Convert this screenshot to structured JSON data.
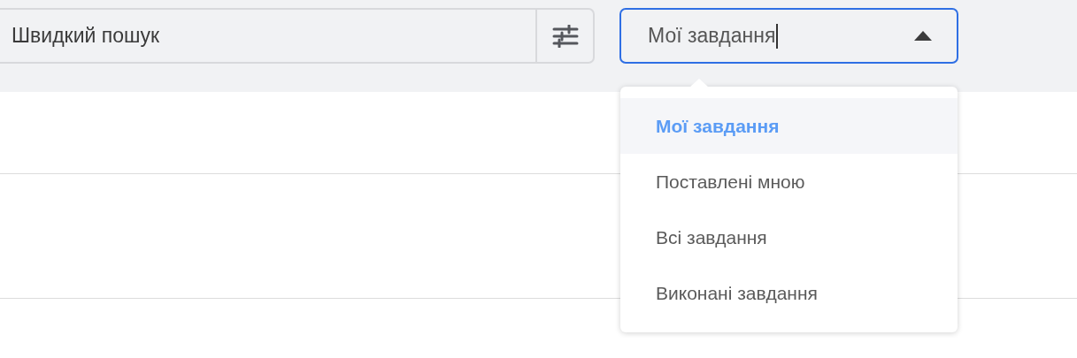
{
  "search": {
    "placeholder": "Швидкий пошук"
  },
  "task_filter": {
    "value": "Мої завдання",
    "expanded": true,
    "options": [
      {
        "label": "Мої завдання",
        "selected": true
      },
      {
        "label": "Поставлені мною",
        "selected": false
      },
      {
        "label": "Всі завдання",
        "selected": false
      },
      {
        "label": "Виконані завдання",
        "selected": false
      }
    ]
  }
}
